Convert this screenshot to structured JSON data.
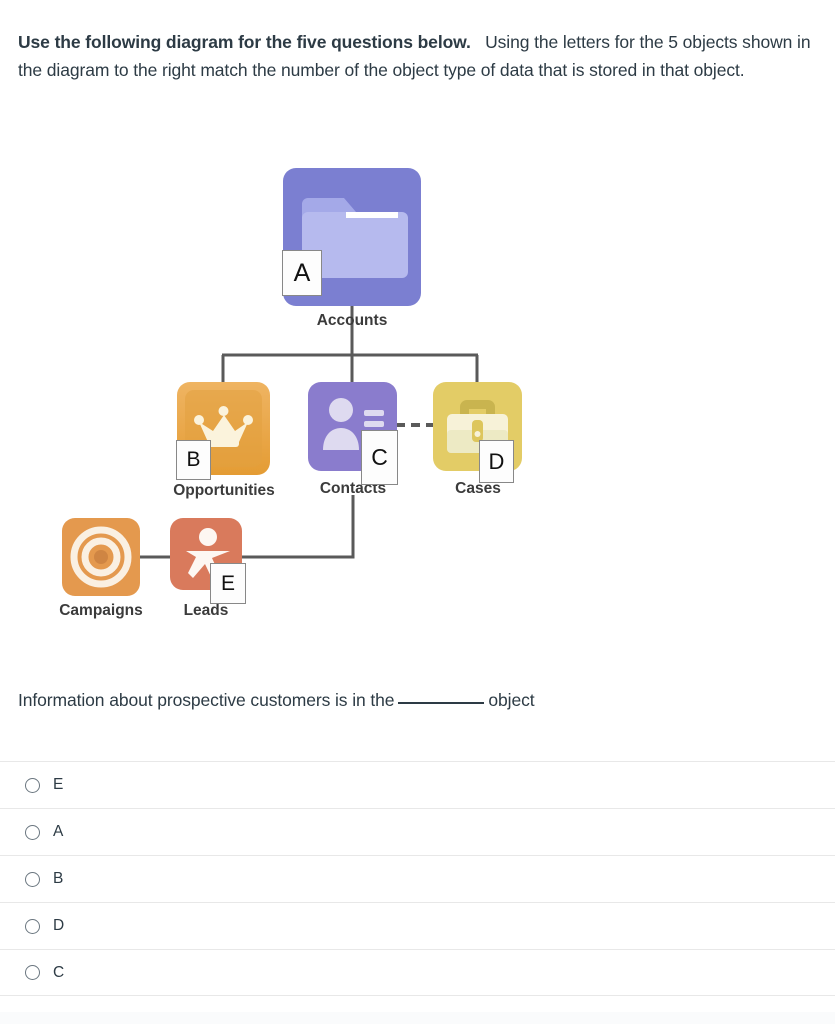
{
  "prompt": {
    "bold_part": "Use the following diagram for the five questions below.",
    "rest": "Using the letters for the 5 objects shown in the diagram to the right  match the number of the object type of data that is stored in that object."
  },
  "diagram": {
    "nodes": [
      {
        "id": "accounts",
        "label": "Accounts",
        "letter": "A",
        "icon": "folder-icon",
        "color": "#7b7fd1"
      },
      {
        "id": "opportunities",
        "label": "Opportunities",
        "letter": "B",
        "icon": "crown-icon",
        "color": "#e6a23c"
      },
      {
        "id": "contacts",
        "label": "Contacts",
        "letter": "C",
        "icon": "contact-icon",
        "color": "#8a7ccd"
      },
      {
        "id": "cases",
        "label": "Cases",
        "letter": "D",
        "icon": "briefcase-icon",
        "color": "#e3cc66"
      },
      {
        "id": "campaigns",
        "label": "Campaigns",
        "letter": "",
        "icon": "target-icon",
        "color": "#e4994e"
      },
      {
        "id": "leads",
        "label": "Leads",
        "letter": "E",
        "icon": "person-icon",
        "color": "#d97a5c"
      }
    ],
    "connector_color": "#5a5a5a"
  },
  "question": {
    "before_blank": "Information about prospective customers is in the",
    "after_blank": "object"
  },
  "options": [
    {
      "value": "E",
      "selected": false
    },
    {
      "value": "A",
      "selected": false
    },
    {
      "value": "B",
      "selected": false
    },
    {
      "value": "D",
      "selected": false
    },
    {
      "value": "C",
      "selected": false
    }
  ]
}
